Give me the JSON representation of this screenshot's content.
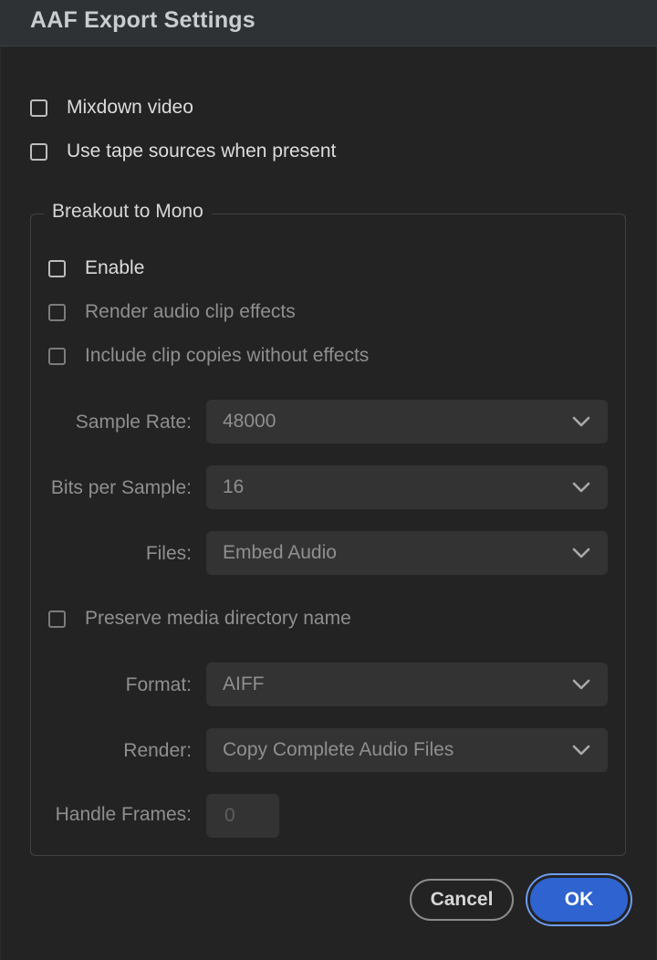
{
  "window": {
    "title": "AAF Export Settings"
  },
  "options": {
    "mixdown_video": {
      "label": "Mixdown video",
      "checked": false
    },
    "use_tape_sources": {
      "label": "Use tape sources when present",
      "checked": false
    }
  },
  "breakout": {
    "legend": "Breakout to Mono",
    "enable": {
      "label": "Enable",
      "checked": false
    },
    "render_audio_clip_effects": {
      "label": "Render audio clip effects",
      "checked": false
    },
    "include_clip_copies": {
      "label": "Include clip copies without effects",
      "checked": false
    },
    "sample_rate": {
      "label": "Sample Rate:",
      "value": "48000"
    },
    "bits_per_sample": {
      "label": "Bits per Sample:",
      "value": "16"
    },
    "files": {
      "label": "Files:",
      "value": "Embed Audio"
    },
    "preserve_media_dir": {
      "label": "Preserve media directory name",
      "checked": false
    },
    "format": {
      "label": "Format:",
      "value": "AIFF"
    },
    "render": {
      "label": "Render:",
      "value": "Copy Complete Audio Files"
    },
    "handle_frames": {
      "label": "Handle Frames:",
      "value": "0"
    }
  },
  "buttons": {
    "cancel": "Cancel",
    "ok": "OK"
  },
  "colors": {
    "accent": "#2f63cf",
    "background": "#232323",
    "control": "#333333"
  },
  "icons": {
    "dropdown": "chevron-down-icon"
  }
}
